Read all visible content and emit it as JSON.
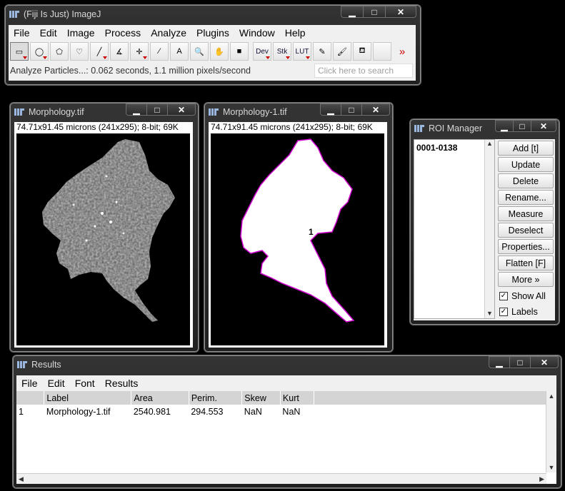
{
  "main_window": {
    "title": "(Fiji Is Just) ImageJ",
    "menu": [
      "File",
      "Edit",
      "Image",
      "Process",
      "Analyze",
      "Plugins",
      "Window",
      "Help"
    ],
    "tools": [
      {
        "name": "rectangle-tool-icon",
        "glyph": "▭",
        "selected": true,
        "submenu": true
      },
      {
        "name": "oval-tool-icon",
        "glyph": "◯",
        "submenu": true
      },
      {
        "name": "polygon-tool-icon",
        "glyph": "⬠",
        "submenu": false
      },
      {
        "name": "freehand-tool-icon",
        "glyph": "♡",
        "submenu": false
      },
      {
        "name": "line-tool-icon",
        "glyph": "╱",
        "submenu": true
      },
      {
        "name": "angle-tool-icon",
        "glyph": "∡",
        "submenu": false
      },
      {
        "name": "point-tool-icon",
        "glyph": "✛",
        "submenu": true
      },
      {
        "name": "wand-tool-icon",
        "glyph": "⁄",
        "submenu": false
      },
      {
        "name": "text-tool-icon",
        "glyph": "A",
        "submenu": false
      },
      {
        "name": "magnifier-tool-icon",
        "glyph": "🔍",
        "submenu": false
      },
      {
        "name": "hand-tool-icon",
        "glyph": "✋",
        "submenu": false
      },
      {
        "name": "color-picker-tool-icon",
        "glyph": "■",
        "submenu": false
      },
      {
        "name": "dev-tool-icon",
        "glyph": "Dev",
        "submenu": true
      },
      {
        "name": "stk-tool-icon",
        "glyph": "Stk",
        "submenu": true
      },
      {
        "name": "lut-tool-icon",
        "glyph": "LUT",
        "submenu": true
      },
      {
        "name": "pencil-tool-icon",
        "glyph": "✎",
        "submenu": false
      },
      {
        "name": "brush-tool-icon",
        "glyph": "🖌",
        "submenu": false
      },
      {
        "name": "flood-fill-tool-icon",
        "glyph": "⛾",
        "submenu": false
      },
      {
        "name": "empty-tool-slot",
        "glyph": "",
        "submenu": false
      },
      {
        "name": "more-tools-icon",
        "glyph": "»",
        "submenu": false
      }
    ],
    "status": "Analyze Particles...: 0.062 seconds, 1.1 million pixels/second",
    "search_placeholder": "Click here to search"
  },
  "image1": {
    "title": "Morphology.tif",
    "info": "74.71x91.45 microns (241x295); 8-bit; 69K"
  },
  "image2": {
    "title": "Morphology-1.tif",
    "info": "74.71x91.45 microns (241x295); 8-bit; 69K",
    "roi_label": "1"
  },
  "roi_manager": {
    "title": "ROI Manager",
    "list": [
      "0001-0138"
    ],
    "buttons": [
      "Add [t]",
      "Update",
      "Delete",
      "Rename...",
      "Measure",
      "Deselect",
      "Properties...",
      "Flatten [F]",
      "More »"
    ],
    "show_all": "Show All",
    "labels": "Labels"
  },
  "results": {
    "title": "Results",
    "menu": [
      "File",
      "Edit",
      "Font",
      "Results"
    ],
    "columns": [
      "",
      "Label",
      "Area",
      "Perim.",
      "Skew",
      "Kurt"
    ],
    "rows": [
      [
        "1",
        "Morphology-1.tif",
        "2540.981",
        "294.553",
        "NaN",
        "NaN"
      ]
    ]
  },
  "colors": {
    "roi_outline": "#d000d0",
    "window_chrome": "#2a2a2a",
    "client_bg": "#f0f0f0"
  }
}
